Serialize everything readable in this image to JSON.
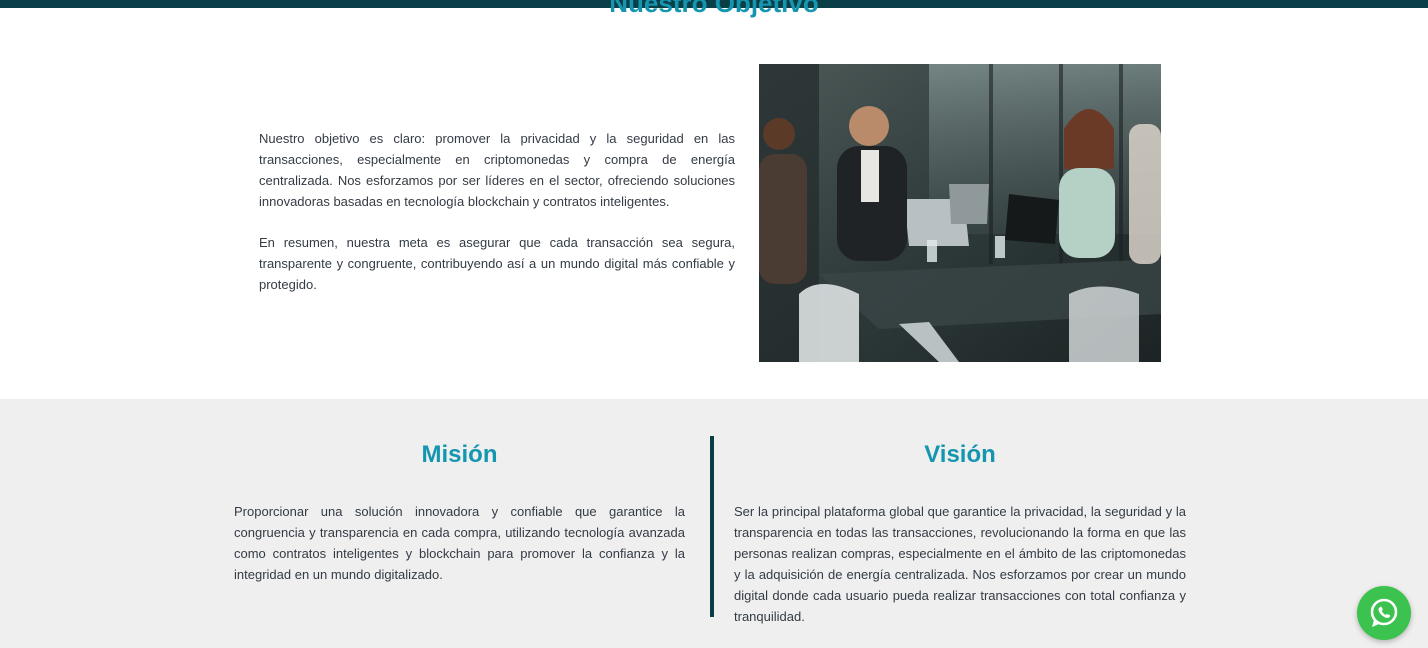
{
  "objective": {
    "title": "Nuestro Objetivo",
    "paragraphs": [
      "Nuestro objetivo es claro: promover la privacidad y la seguridad en las transacciones, especialmente en criptomonedas y compra de energía centralizada. Nos esforzamos por ser líderes en el sector, ofreciendo soluciones innovadoras basadas en tecnología blockchain y contratos inteligentes.",
      "En resumen, nuestra meta es asegurar que cada transacción sea segura, transparente y congruente, contribuyendo así a un mundo digital más confiable y protegido."
    ]
  },
  "mission": {
    "title": "Misión",
    "text": "Proporcionar una solución innovadora y confiable que garantice la congruencia y transparencia en cada compra, utilizando tecnología avanzada como contratos inteligentes y blockchain para promover la confianza y la integridad en un mundo digitalizado."
  },
  "vision": {
    "title": "Visión",
    "text": "Ser la principal plataforma global que garantice la privacidad, la seguridad y la transparencia en todas las transacciones, revolucionando la forma en que las personas realizan compras, especialmente en el ámbito de las criptomonedas y la adquisición de energía centralizada. Nos esforzamos por crear un mundo digital donde cada usuario pueda realizar transacciones con total confianza y tranquilidad."
  },
  "colors": {
    "accent": "#1496b1",
    "dark_teal": "#0b3f47",
    "section_bg": "#efefef",
    "whatsapp_green": "#3cc24e"
  },
  "icons": {
    "whatsapp": "whatsapp-icon"
  }
}
